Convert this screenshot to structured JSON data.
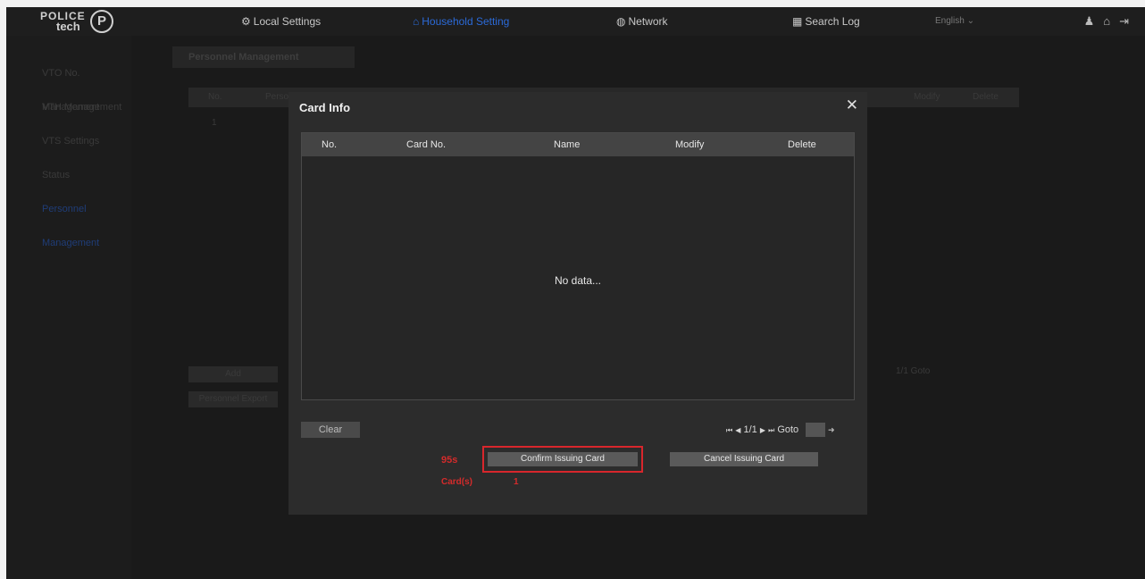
{
  "logo": {
    "line1": "POLICE",
    "line2": "tech",
    "mark": "P"
  },
  "nav": [
    {
      "label": "Local Settings",
      "icon": "gear-icon",
      "glyph": "⚙"
    },
    {
      "label": "Household Setting",
      "icon": "household-icon",
      "glyph": "⌂"
    },
    {
      "label": "Network",
      "icon": "network-icon",
      "glyph": "◍"
    },
    {
      "label": "Search Log",
      "icon": "search-log-icon",
      "glyph": "▦"
    },
    {
      "label": "English",
      "icon": "chevron-down-icon",
      "glyph": "⌄"
    }
  ],
  "top_icons": [
    {
      "name": "user-icon",
      "glyph": "♟"
    },
    {
      "name": "home-icon",
      "glyph": "⌂"
    },
    {
      "name": "logout-icon",
      "glyph": "⇥"
    }
  ],
  "sidebar": {
    "items": [
      {
        "label": "VTO No. Management"
      },
      {
        "label": "VTH Management"
      },
      {
        "label": "VTS Settings"
      },
      {
        "label": "Status"
      },
      {
        "label": "Personnel Management"
      }
    ]
  },
  "background": {
    "tab": "Personnel Management",
    "headers": [
      "No.",
      "Person",
      "Modify",
      "Delete"
    ],
    "row_no": "1",
    "add_label": "Add",
    "export_label": "Personnel Export",
    "pager": "1/1  Goto"
  },
  "modal": {
    "title": "Card Info",
    "close_glyph": "✕",
    "table": {
      "headers": [
        "No.",
        "Card No.",
        "Name",
        "Modify",
        "Delete"
      ],
      "empty_text": "No data..."
    },
    "clear_label": "Clear",
    "pager": {
      "first": "⏮",
      "prev": "◀",
      "page": "1/1",
      "next": "▶",
      "last": "⏭",
      "goto_label": "Goto",
      "goto_value": "",
      "go_glyph": "➜"
    },
    "countdown": "95s",
    "confirm_label": "Confirm Issuing Card",
    "cancel_label": "Cancel Issuing Card",
    "cards_label": "Card(s)",
    "cards_value": "1"
  },
  "colors": {
    "accent": "#2b6ad8",
    "alert": "#d42b2b",
    "highlight_border": "#d8262c"
  }
}
